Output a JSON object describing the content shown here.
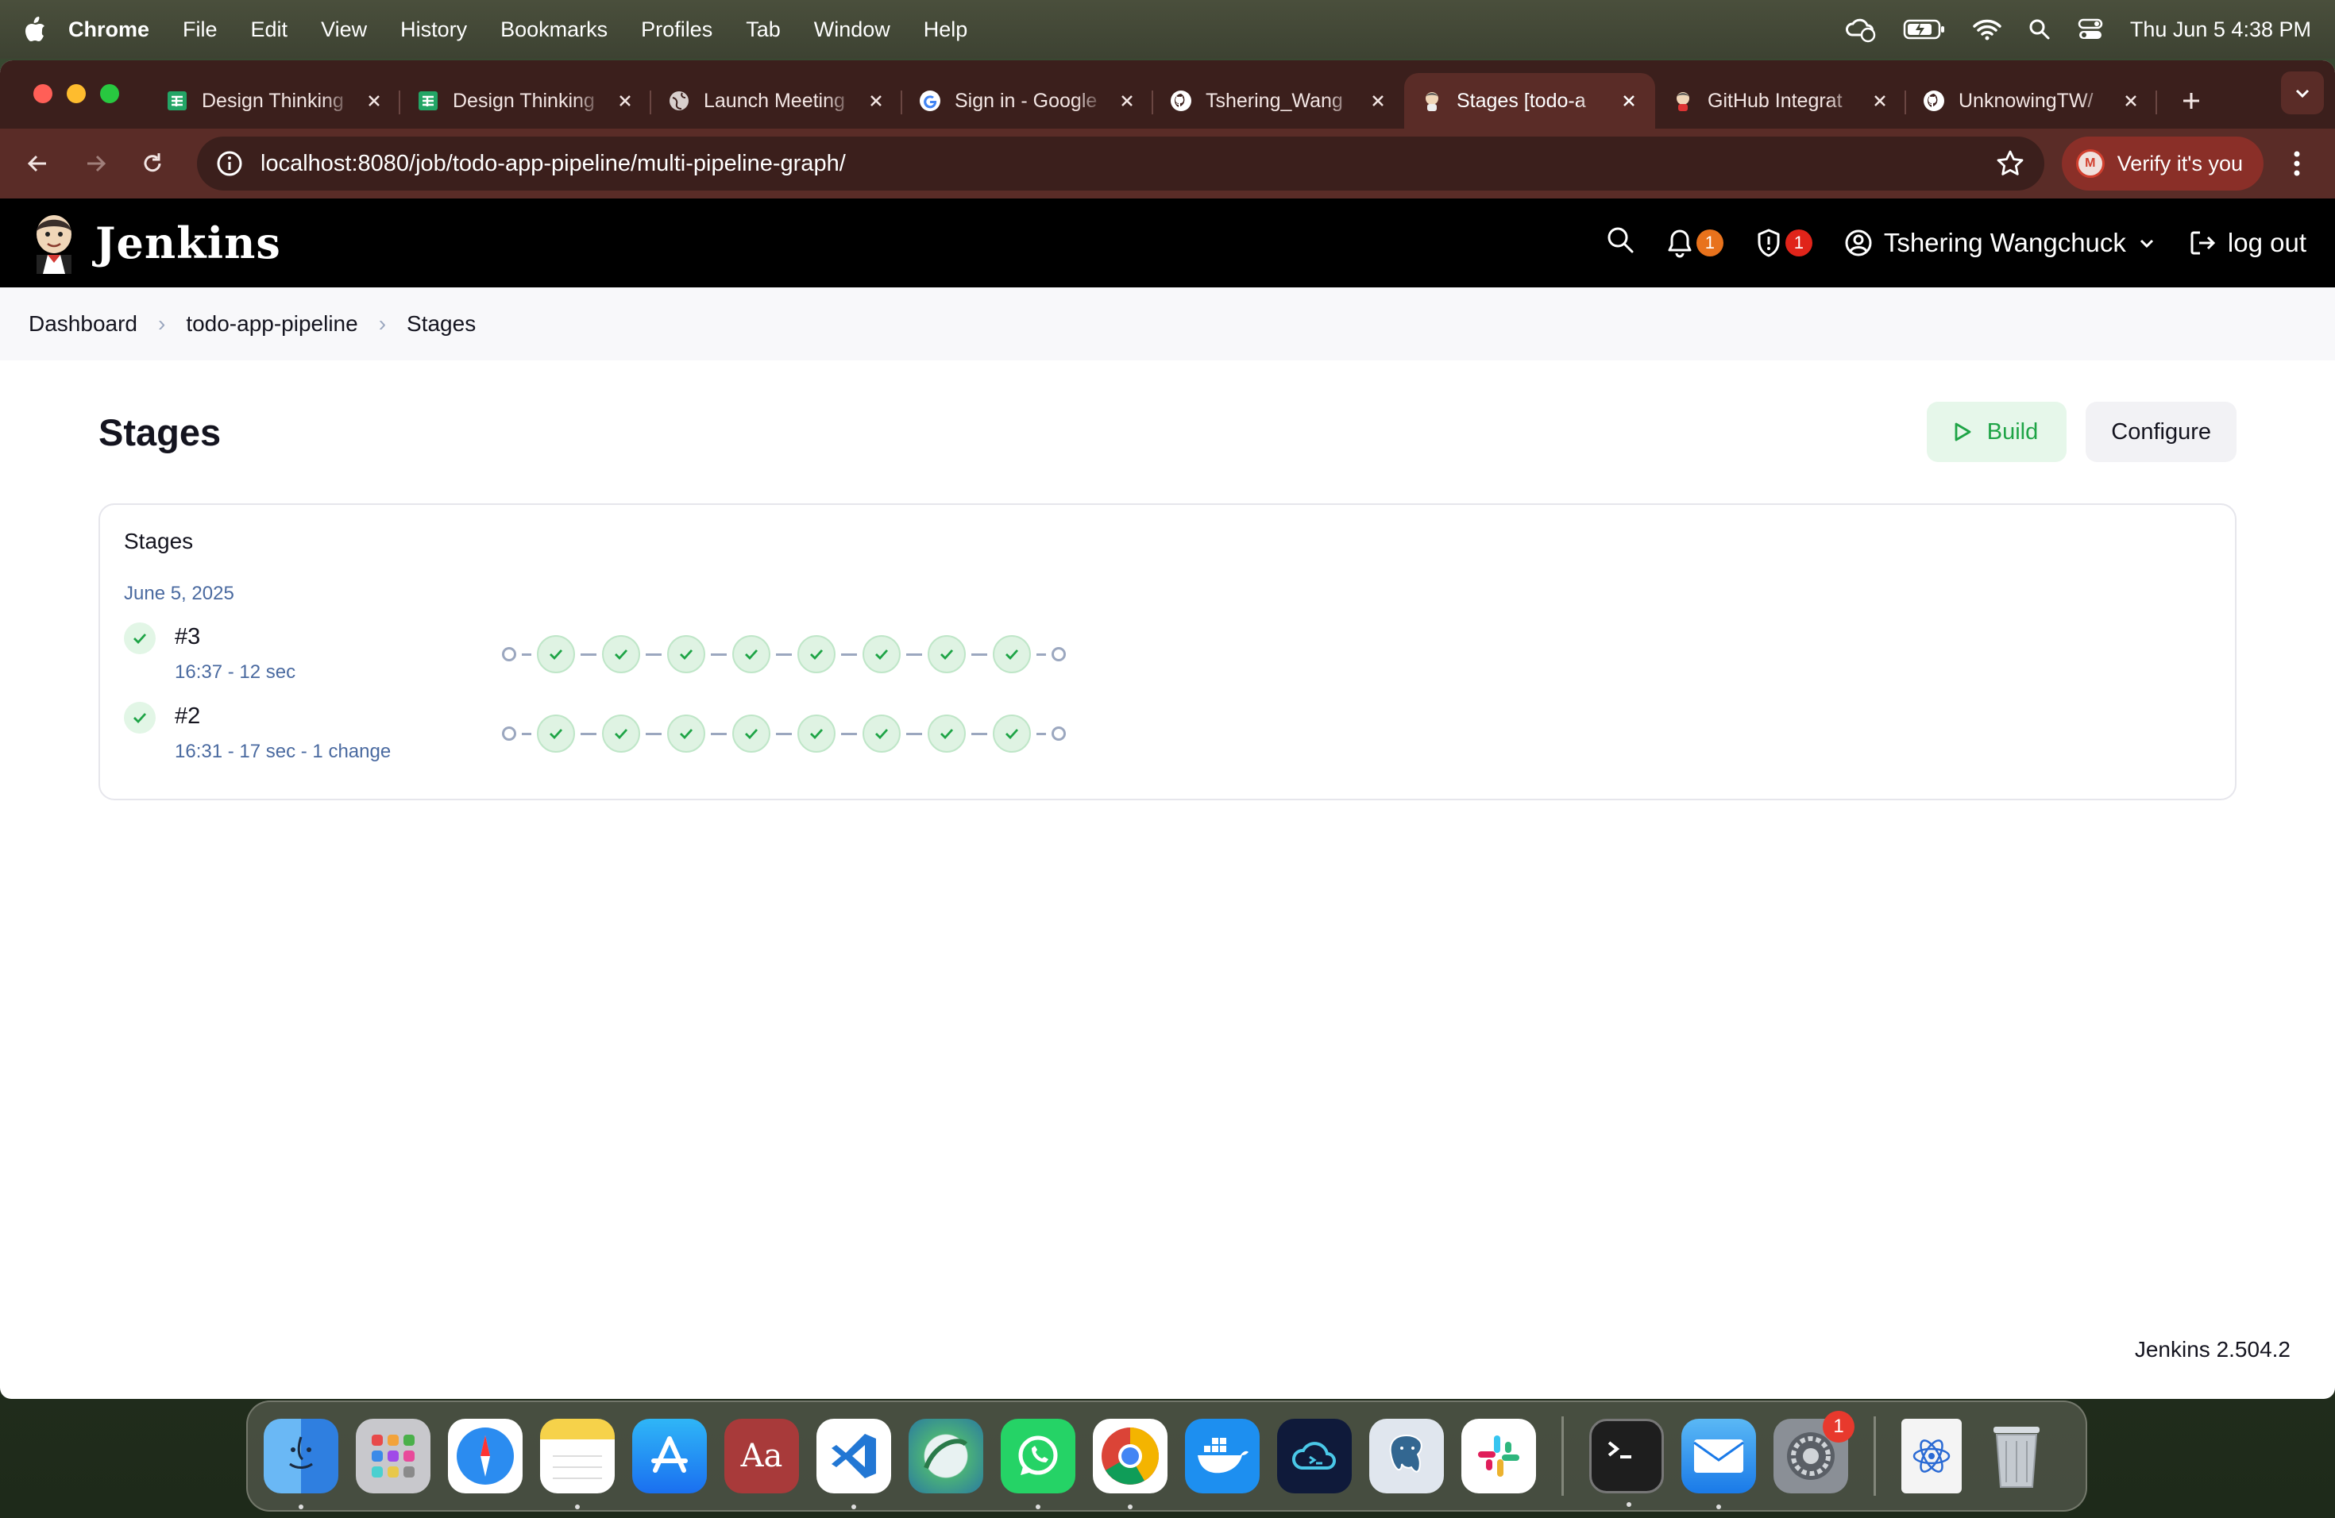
{
  "menubar": {
    "app": "Chrome",
    "items": [
      "File",
      "Edit",
      "View",
      "History",
      "Bookmarks",
      "Profiles",
      "Tab",
      "Window",
      "Help"
    ],
    "clock": "Thu Jun 5  4:38 PM"
  },
  "tabs": [
    {
      "title": "Design Thinking",
      "icon": "sheets-icon"
    },
    {
      "title": "Design Thinking",
      "icon": "sheets-icon"
    },
    {
      "title": "Launch Meeting",
      "icon": "globe-icon"
    },
    {
      "title": "Sign in - Google",
      "icon": "google-icon"
    },
    {
      "title": "Tshering_Wang",
      "icon": "github-icon"
    },
    {
      "title": "Stages [todo-a",
      "icon": "jenkins-icon",
      "active": true
    },
    {
      "title": "GitHub Integrat",
      "icon": "jenkins-icon"
    },
    {
      "title": "UnknowingTW/",
      "icon": "github-icon"
    }
  ],
  "toolbar": {
    "url": "localhost:8080/job/todo-app-pipeline/multi-pipeline-graph/",
    "verify_label": "Verify it's you",
    "avatar_letter": "M"
  },
  "jenkins": {
    "brand": "Jenkins",
    "notifications_count": "1",
    "security_count": "1",
    "user_name": "Tshering Wangchuck",
    "logout_label": "log out"
  },
  "breadcrumbs": [
    "Dashboard",
    "todo-app-pipeline",
    "Stages"
  ],
  "page": {
    "title": "Stages",
    "build_label": "Build",
    "configure_label": "Configure"
  },
  "card": {
    "title": "Stages",
    "date": "June 5, 2025",
    "runs": [
      {
        "number": "#3",
        "meta": "16:37 - 12 sec",
        "stages": 8,
        "status": "success"
      },
      {
        "number": "#2",
        "meta": "16:31 - 17 sec - 1 change",
        "stages": 8,
        "status": "success"
      }
    ]
  },
  "footer": {
    "version": "Jenkins 2.504.2"
  },
  "colors": {
    "success": "#1ea446",
    "accent_badge_orange": "#e8721c",
    "accent_badge_red": "#e0241a",
    "chrome_tab_bg": "#3b1f1c"
  },
  "dock": {
    "apps": [
      "finder-icon",
      "launchpad-icon",
      "safari-icon",
      "notes-icon",
      "app-store-icon",
      "dictionary-icon",
      "vscode-icon",
      "browser-icon",
      "whatsapp-icon",
      "chrome-icon",
      "docker-icon",
      "cloud-app-icon",
      "postgres-icon",
      "slack-icon",
      "terminal-icon",
      "mail-icon",
      "system-settings-icon",
      "file-icon",
      "trash-icon"
    ],
    "dictionary_label": "Aa",
    "settings_badge": "1"
  }
}
